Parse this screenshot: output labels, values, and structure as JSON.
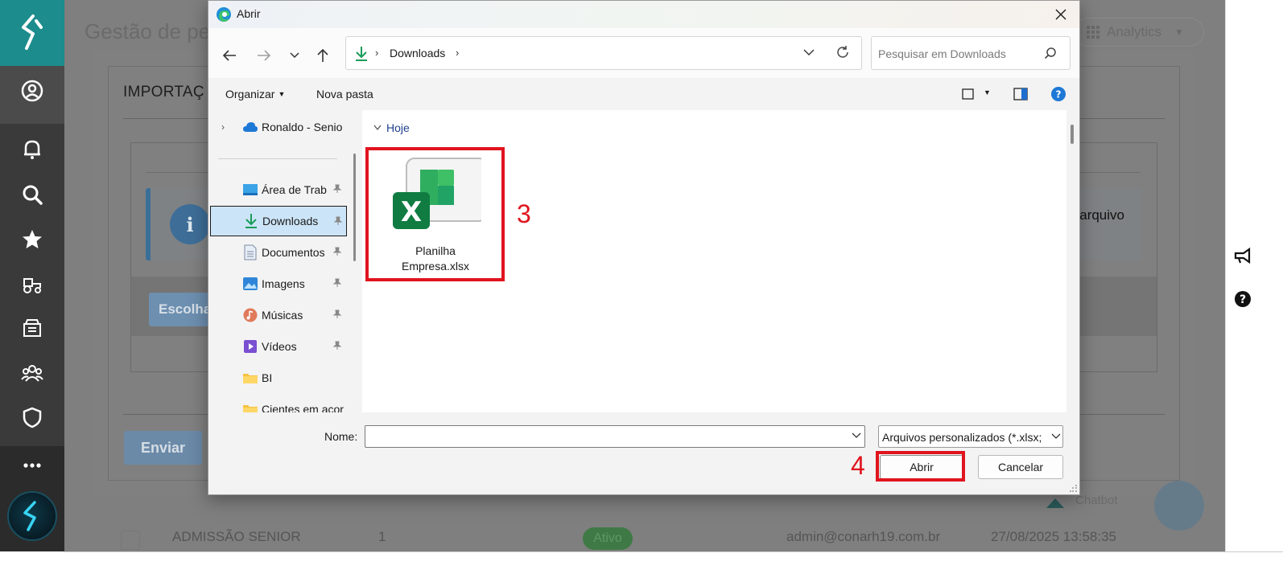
{
  "background": {
    "page_title": "Gestão de pe",
    "analytics_label": "Analytics",
    "import_title": "IMPORTAÇ",
    "info_text": "arquivo",
    "choose_button": "Escolha",
    "send_button": "Enviar",
    "chatbot_label": "Chatbot",
    "table_row": {
      "name": "ADMISSÃO SENIOR",
      "count": "1",
      "status": "Ativo",
      "email": "admin@conarh19.com.br",
      "datetime": "27/08/2025 13:58:35"
    },
    "sidebar_icons": [
      "logo-icon",
      "user-circle-icon",
      "bell-icon",
      "search-icon",
      "star-icon",
      "tractor-icon",
      "archive-box-icon",
      "team-icon",
      "shield-icon",
      "more-icon",
      "assistant-orb-icon"
    ],
    "colors": {
      "sidebar": "#3a3a3a",
      "logo_tile": "#1c8c8c",
      "overlay": "#7f7f7f"
    }
  },
  "dialog": {
    "title": "Abrir",
    "address": {
      "crumb": "Downloads"
    },
    "search": {
      "placeholder": "Pesquisar em Downloads"
    },
    "commands": {
      "organize": "Organizar",
      "new_folder": "Nova pasta"
    },
    "nav_pane": [
      {
        "label": "Ronaldo - Senio",
        "icon": "onedrive-cloud-icon",
        "pinned": false,
        "expand": true
      },
      {
        "label": "Área de Trab",
        "icon": "desktop-icon",
        "pinned": true
      },
      {
        "label": "Downloads",
        "icon": "download-icon",
        "pinned": true,
        "selected": true
      },
      {
        "label": "Documentos",
        "icon": "document-icon",
        "pinned": true
      },
      {
        "label": "Imagens",
        "icon": "pictures-icon",
        "pinned": true
      },
      {
        "label": "Músicas",
        "icon": "music-icon",
        "pinned": true
      },
      {
        "label": "Vídeos",
        "icon": "video-icon",
        "pinned": true
      },
      {
        "label": "BI",
        "icon": "folder-icon",
        "pinned": false
      },
      {
        "label": "Cientes em acor",
        "icon": "folder-icon",
        "pinned": false
      }
    ],
    "group_header": "Hoje",
    "file": {
      "name_line1": "Planilha",
      "name_line2": "Empresa.xlsx",
      "icon": "excel-file-icon"
    },
    "bottom": {
      "name_label": "Nome:",
      "name_value": "",
      "filter": "Arquivos personalizados (*.xlsx;",
      "open_button": "Abrir",
      "cancel_button": "Cancelar"
    },
    "colors": {
      "selected_nav": "#cce4f7",
      "group_header": "#1f3f8f"
    }
  },
  "annotations": [
    {
      "number": "3",
      "color": "#e0141e"
    },
    {
      "number": "4",
      "color": "#e0141e"
    }
  ]
}
